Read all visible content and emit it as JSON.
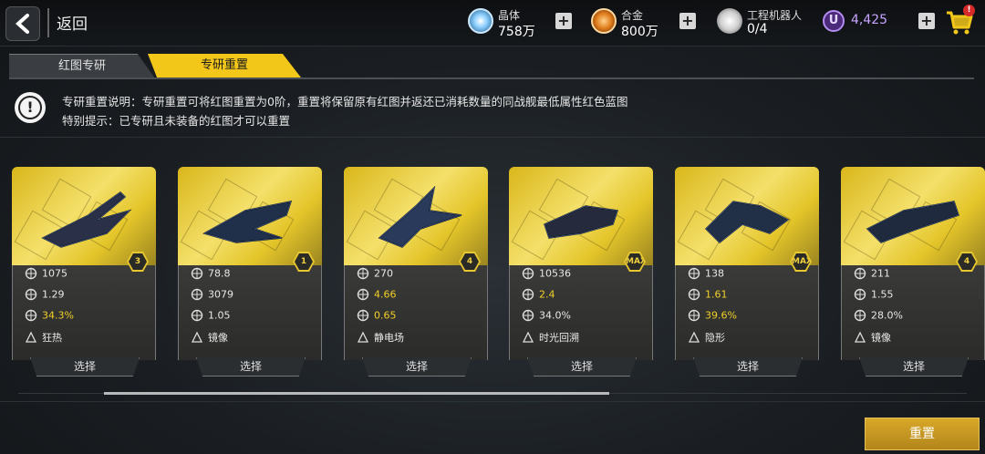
{
  "header": {
    "back_label": "返回",
    "resources": [
      {
        "name": "晶体",
        "value": "758万",
        "icon": "crystal-icon"
      },
      {
        "name": "合金",
        "value": "800万",
        "icon": "alloy-icon"
      },
      {
        "name": "工程机器人",
        "value": "0/4",
        "icon": "robot-icon"
      }
    ],
    "currency_value": "4,425",
    "currency_letter": "U",
    "cart_badge": "!"
  },
  "tabs": [
    {
      "label": "红图专研",
      "active": false
    },
    {
      "label": "专研重置",
      "active": true
    }
  ],
  "notice": {
    "line1": "专研重置说明：专研重置可将红图重置为0阶，重置将保留原有红图并返还已消耗数量的同战舰最低属性红色蓝图",
    "line2": "特别提示：已专研且未装备的红图才可以重置"
  },
  "cards": [
    {
      "badge": "3",
      "stats": [
        "1075",
        "1.29",
        "34.3%"
      ],
      "stat_icons": [
        "cluster-icon",
        "crosshair-icon",
        "speed-icon"
      ],
      "highlight": [
        false,
        false,
        true
      ],
      "skill": "狂热",
      "skill_icon": "frenzy-icon",
      "select": "选择"
    },
    {
      "badge": "1",
      "stats": [
        "78.8",
        "3079",
        "1.05"
      ],
      "stat_icons": [
        "arrow-icon",
        "dome-icon",
        "crosshair-icon"
      ],
      "highlight": [
        false,
        false,
        false
      ],
      "skill": "镜像",
      "skill_icon": "mirror-icon",
      "select": "选择"
    },
    {
      "badge": "4",
      "stats": [
        "270",
        "4.66",
        "0.65"
      ],
      "stat_icons": [
        "ammo-icon",
        "gear-icon",
        "crosshair-icon"
      ],
      "highlight": [
        false,
        true,
        true
      ],
      "skill": "静电场",
      "skill_icon": "static-icon",
      "select": "选择"
    },
    {
      "badge": "MAX",
      "stats": [
        "10536",
        "2.4",
        "34.0%"
      ],
      "stat_icons": [
        "dome-icon",
        "gear-icon",
        "speed-icon"
      ],
      "highlight": [
        false,
        true,
        false
      ],
      "skill": "时光回溯",
      "skill_icon": "rewind-icon",
      "select": "选择"
    },
    {
      "badge": "MAX",
      "stats": [
        "138",
        "1.61",
        "39.6%"
      ],
      "stat_icons": [
        "arrow-icon",
        "crosshair-icon",
        "speed-icon"
      ],
      "highlight": [
        false,
        true,
        true
      ],
      "skill": "隐形",
      "skill_icon": "stealth-icon",
      "select": "选择"
    },
    {
      "badge": "4",
      "stats": [
        "211",
        "1.55",
        "28.0%"
      ],
      "stat_icons": [
        "arrow-icon",
        "crosshair-icon",
        "speed-icon"
      ],
      "highlight": [
        false,
        false,
        false
      ],
      "skill": "镜像",
      "skill_icon": "mirror-icon",
      "select": "选择"
    }
  ],
  "reset_button": "重置",
  "colors": {
    "accent": "#f2c71a",
    "highlight_text": "#f2d028",
    "button": "#c4951f"
  }
}
